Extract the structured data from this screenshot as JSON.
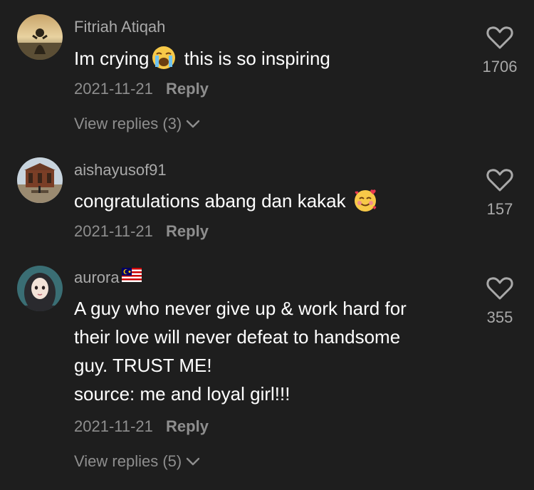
{
  "comments": [
    {
      "username": "Fitriah Atiqah",
      "text_before_emoji": "Im crying",
      "emoji": "loudly-crying-face-emoji",
      "text_after_emoji": " this is so inspiring",
      "date": "2021-11-21",
      "reply_label": "Reply",
      "likes": "1706",
      "view_replies": "View replies (3)"
    },
    {
      "username": "aishayusof91",
      "text_before_emoji": "congratulations abang dan kakak",
      "emoji": "smiling-face-with-hearts-emoji",
      "date": "2021-11-21",
      "reply_label": "Reply",
      "likes": "157"
    },
    {
      "username": "aurora",
      "username_flag": "malaysia-flag-emoji",
      "lines": [
        "A guy who never give up & work hard for",
        "their love will never defeat to handsome",
        "guy. TRUST ME!",
        "source: me and loyal girl!!!"
      ],
      "date": "2021-11-21",
      "reply_label": "Reply",
      "likes": "355",
      "view_replies": "View replies (5)"
    }
  ],
  "colors": {
    "background": "#1e1e1e",
    "text": "#ffffff",
    "muted": "#8e8e8e",
    "username": "#a9a9a9"
  },
  "icons": {
    "like": "heart-outline-icon",
    "expand": "chevron-down-icon"
  }
}
